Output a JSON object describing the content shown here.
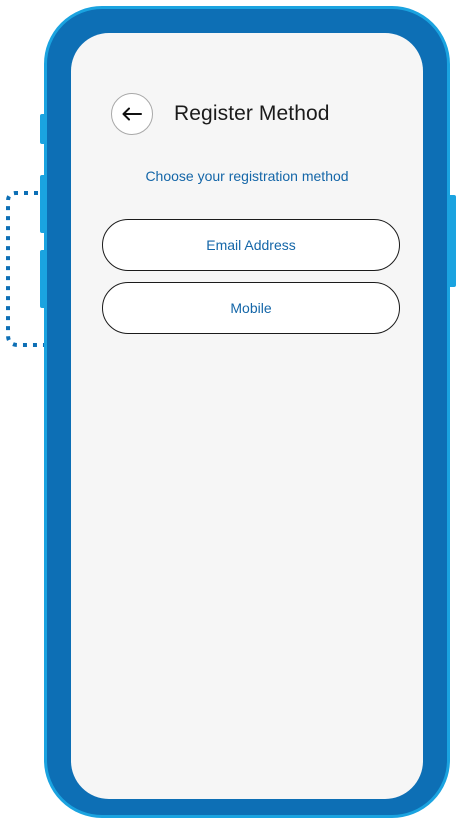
{
  "screen": {
    "title": "Register Method",
    "back_icon": "arrow-left-icon",
    "subtitle": "Choose your registration method",
    "methods": [
      {
        "label": "Email Address"
      },
      {
        "label": "Mobile"
      }
    ]
  },
  "colors": {
    "phone_frame": "#0d6fb5",
    "phone_frame_edge": "#1aa3e0",
    "screen_bg": "#f6f6f6",
    "accent_text": "#1466a8",
    "title_text": "#1b1b1b"
  }
}
